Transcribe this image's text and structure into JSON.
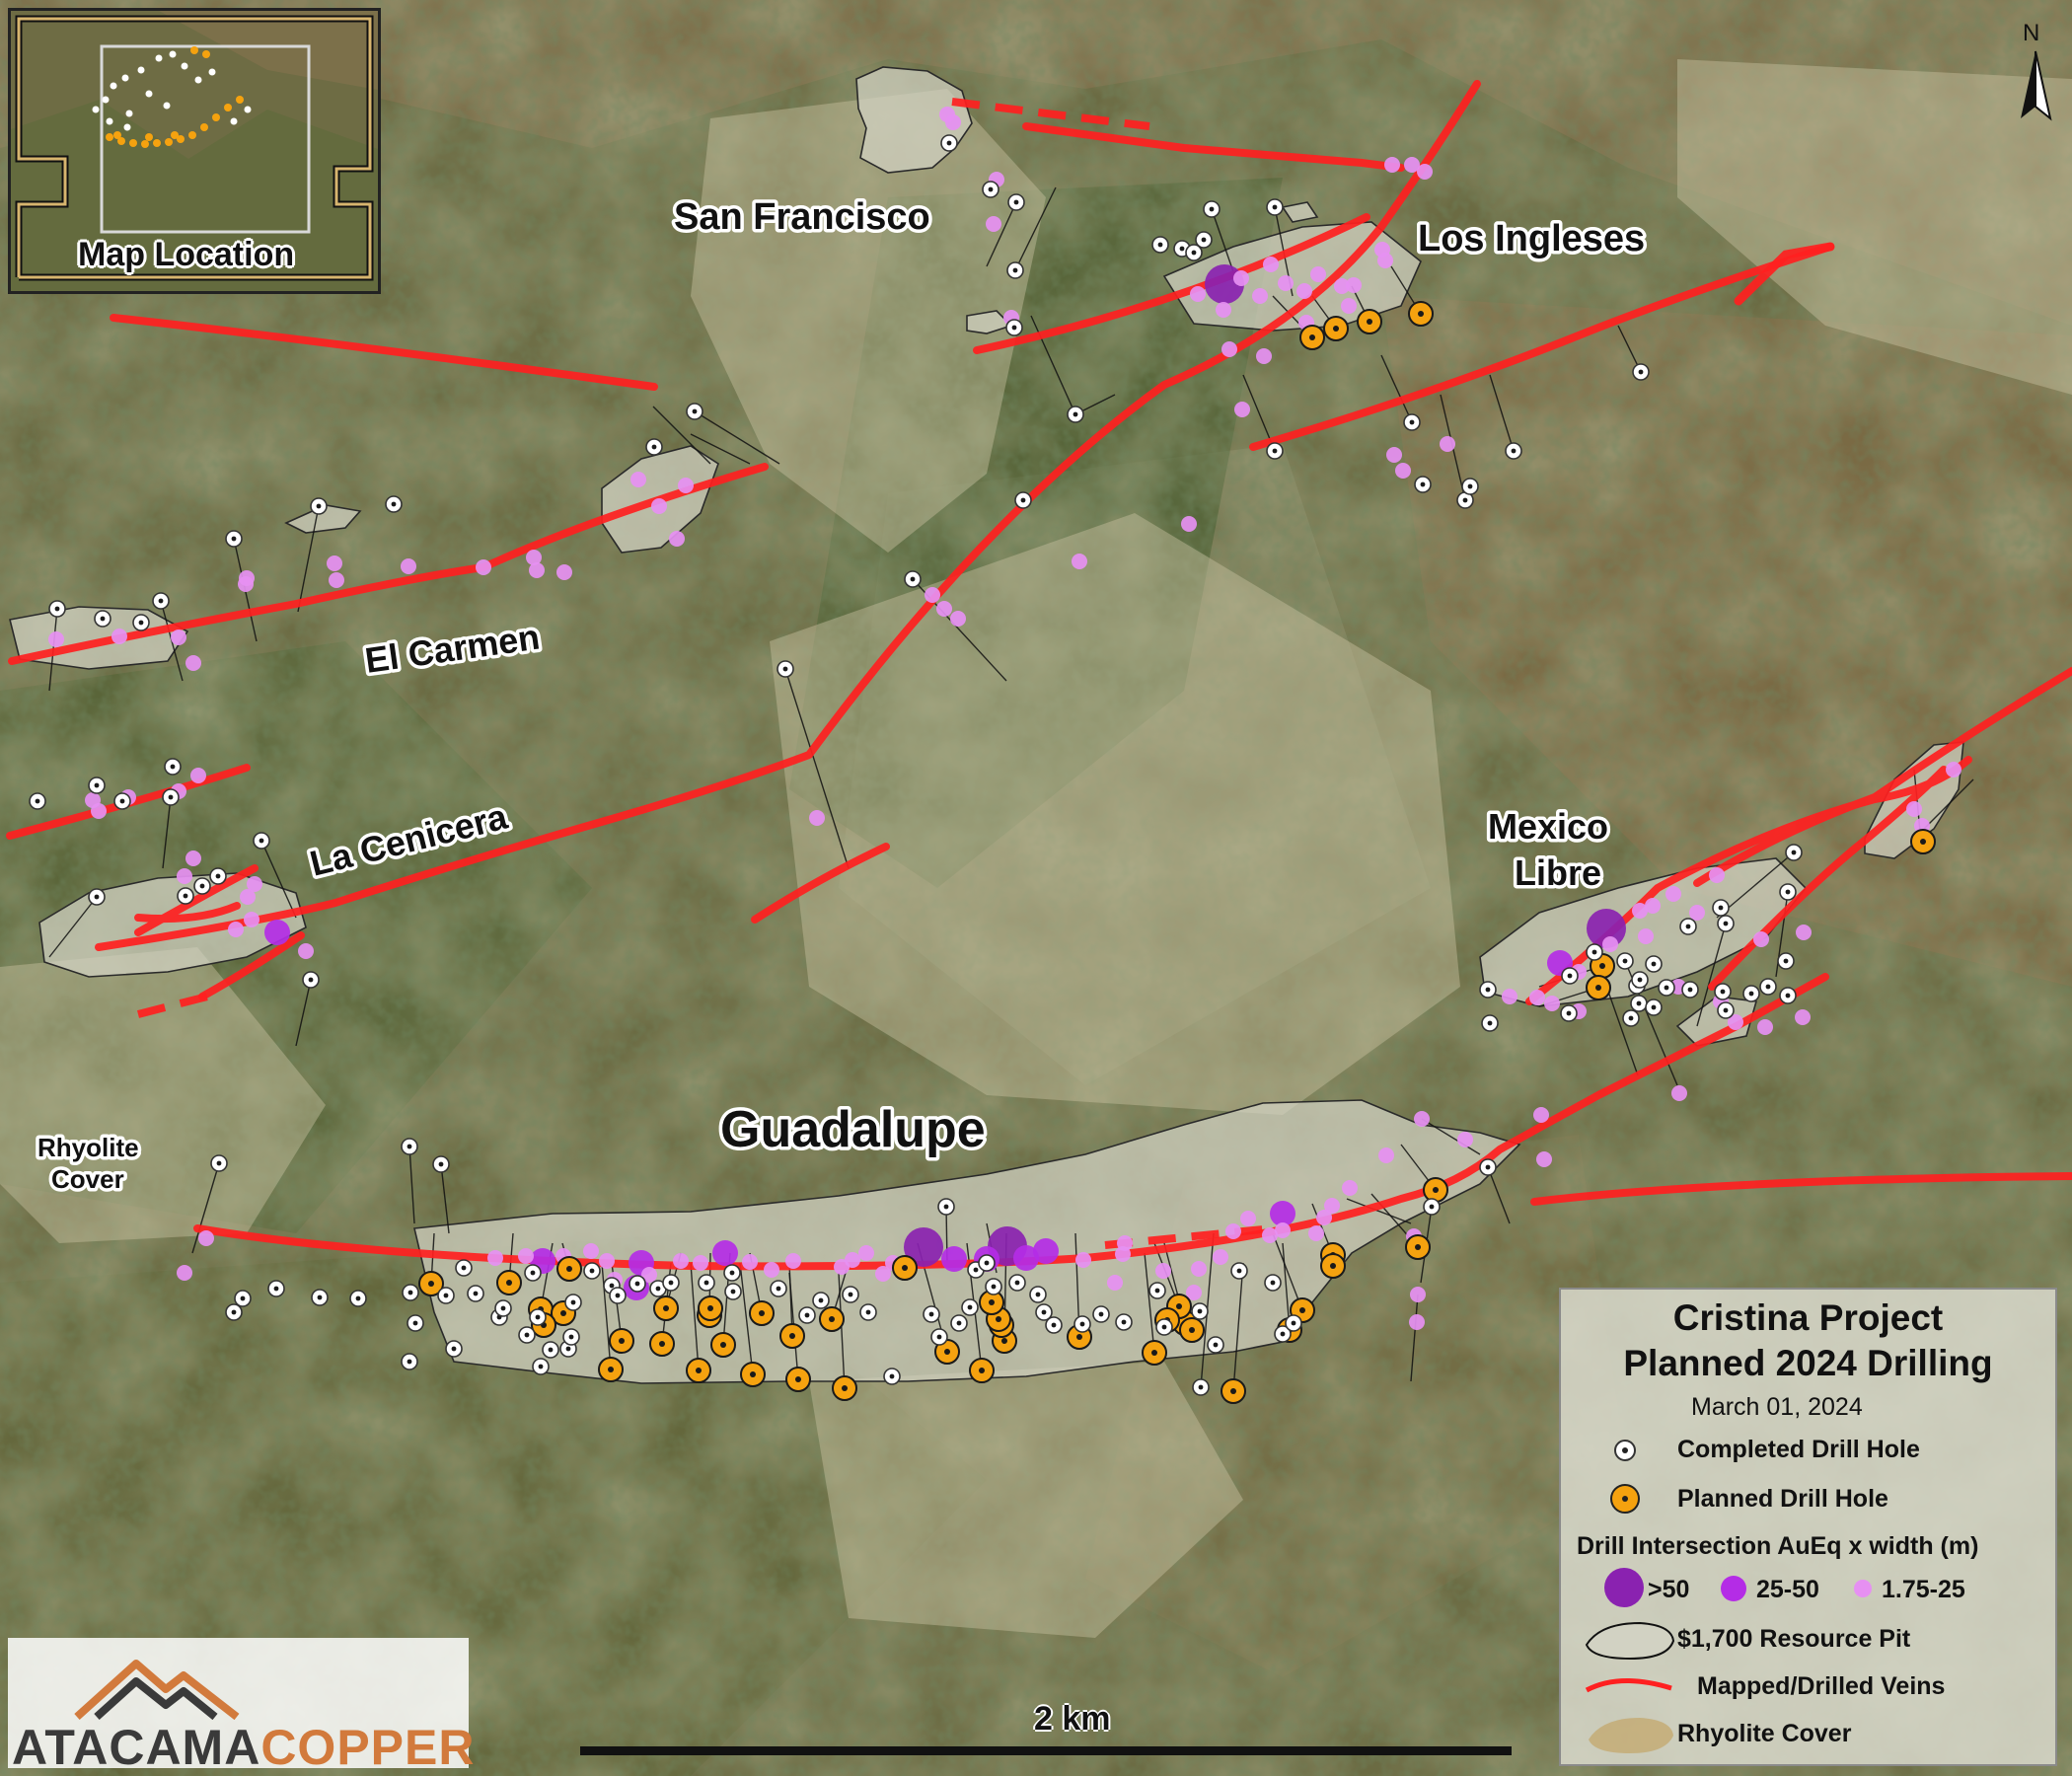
{
  "title": "Cristina Project",
  "subtitle": "Planned 2024 Drilling",
  "date": "March 01, 2024",
  "legend": {
    "completed": "Completed Drill Hole",
    "planned": "Planned Drill Hole",
    "intersection_title": "Drill Intersection AuEq x width (m)",
    "size_large": ">50",
    "size_medium": "25-50",
    "size_small": "1.75-25",
    "resource_pit": "$1,700 Resource Pit",
    "veins": "Mapped/Drilled Veins",
    "rhyolite": "Rhyolite Cover"
  },
  "areas": {
    "san_francisco": "San Francisco",
    "los_ingleses": "Los Ingleses",
    "el_carmen": "El Carmen",
    "la_cenicera": "La Cenicera",
    "mexico_libre_1": "Mexico",
    "mexico_libre_2": "Libre",
    "guadalupe": "Guadalupe",
    "rhyolite_1": "Rhyolite",
    "rhyolite_2": "Cover"
  },
  "inset": {
    "label": "Map Location"
  },
  "scale": {
    "label": "2 km"
  },
  "north": {
    "label": "N"
  },
  "logo": {
    "part1": "ATACAMA",
    "part2": "COPPER"
  },
  "colors": {
    "vein": "#ff2020",
    "planned_hole": "#f5a20f",
    "intersection_large": "#8a22b0",
    "intersection_medium": "#b42ce6",
    "intersection_small": "#e690f2",
    "pit_fill": "#d2d2c3",
    "completed_hole": "#ffffff"
  }
}
